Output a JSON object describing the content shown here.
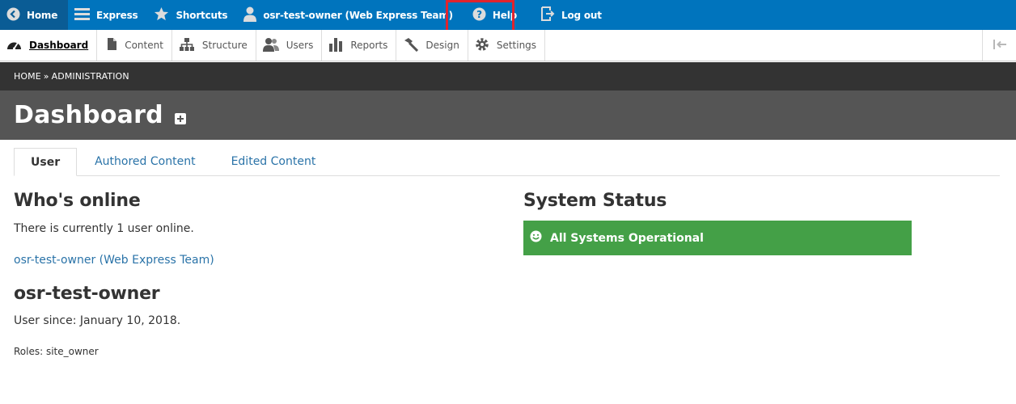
{
  "toolbar": {
    "home_label": "Home",
    "express_label": "Express",
    "shortcuts_label": "Shortcuts",
    "user_label": "osr-test-owner (Web Express Team)",
    "help_label": "Help",
    "logout_label": "Log out",
    "bar_color": "#0074bd",
    "highlight_color": "#e0242e"
  },
  "tray": {
    "items": [
      {
        "label": "Dashboard",
        "icon": "dashboard-icon",
        "active": true
      },
      {
        "label": "Content",
        "icon": "document-icon"
      },
      {
        "label": "Structure",
        "icon": "sitemap-icon"
      },
      {
        "label": "Users",
        "icon": "people-icon"
      },
      {
        "label": "Reports",
        "icon": "bar-chart-icon"
      },
      {
        "label": "Design",
        "icon": "hammer-icon"
      },
      {
        "label": "Settings",
        "icon": "gear-icon"
      }
    ],
    "toggle_icon": "collapse-arrow-icon"
  },
  "breadcrumb": {
    "home": "HOME",
    "separator": "»",
    "current": "ADMINISTRATION"
  },
  "page": {
    "title": "Dashboard"
  },
  "tabs": [
    {
      "label": "User",
      "active": true
    },
    {
      "label": "Authored Content"
    },
    {
      "label": "Edited Content"
    }
  ],
  "whos_online": {
    "heading": "Who's online",
    "text": "There is currently 1 user online.",
    "user_link": "osr-test-owner (Web Express Team)"
  },
  "profile": {
    "name": "osr-test-owner",
    "since": "User since: January 10, 2018.",
    "roles": "Roles: site_owner"
  },
  "system_status": {
    "heading": "System Status",
    "message": "All Systems Operational",
    "color": "#44a047"
  }
}
